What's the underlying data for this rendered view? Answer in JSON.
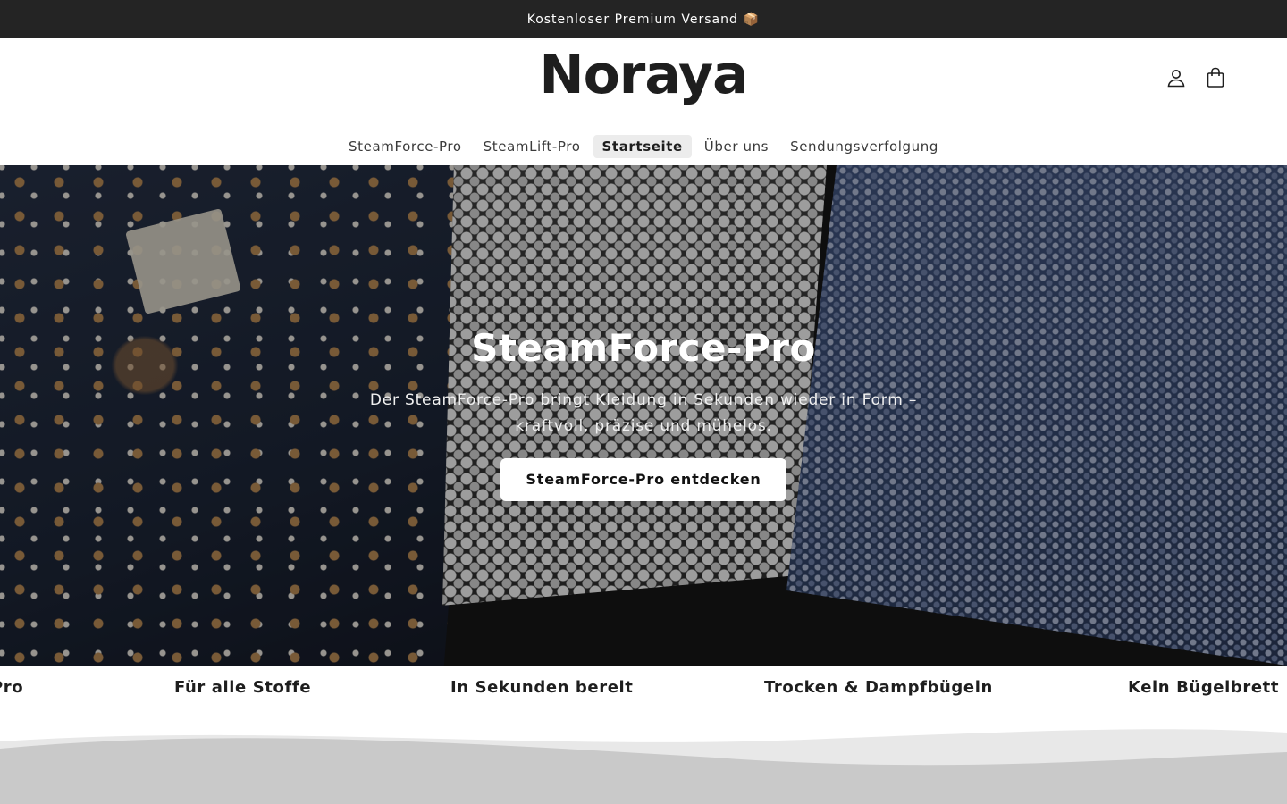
{
  "announcement": {
    "text": "Kostenloser Premium Versand",
    "icon": "package-icon",
    "emoji": "📦"
  },
  "header": {
    "logo": "Noraya",
    "icons": [
      "account-icon",
      "cart-icon"
    ]
  },
  "nav": {
    "items": [
      {
        "label": "SteamForce-Pro",
        "active": false
      },
      {
        "label": "SteamLift-Pro",
        "active": false
      },
      {
        "label": "Startseite",
        "active": true
      },
      {
        "label": "Über uns",
        "active": false
      },
      {
        "label": "Sendungsverfolgung",
        "active": false
      }
    ]
  },
  "hero": {
    "title": "SteamForce-Pro",
    "text": "Der SteamForce-Pro bringt Kleidung in Sekunden wieder in Form – kraftvoll, präzise und mühelos.",
    "button": "SteamForce-Pro entdecken"
  },
  "marquee": {
    "items": [
      "Pro",
      "Für alle Stoffe",
      "In Sekunden bereit",
      "Trocken & Dampfbügeln",
      "Kein Bügelbrett"
    ]
  },
  "colors": {
    "announcement_bg": "#242424",
    "accent": "#1e1e1e",
    "wave_light": "#e8e8e8",
    "wave_dark": "#c9c9c9"
  }
}
